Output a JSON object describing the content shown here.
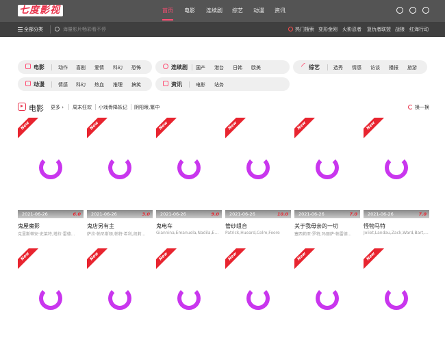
{
  "site": {
    "logo_text": "七度影视"
  },
  "nav": {
    "items": [
      "首页",
      "电影",
      "连续剧",
      "综艺",
      "动漫",
      "资讯"
    ],
    "active_index": 0
  },
  "subbar": {
    "all_categories": "全部分类",
    "search_placeholder": "海量影片畅彩看不停",
    "hot_label": "热门搜索",
    "hot_items": [
      "变形金刚",
      "火影忍者",
      "复仇者联盟",
      "战狼",
      "红海行动"
    ]
  },
  "categories": [
    {
      "title": "电影",
      "items": [
        "动作",
        "喜剧",
        "爱情",
        "科幻",
        "恐怖"
      ]
    },
    {
      "title": "连续剧",
      "items": [
        "国产",
        "港台",
        "日韩",
        "欧美"
      ]
    },
    {
      "title": "综艺",
      "items": [
        "选秀",
        "情感",
        "访谈",
        "播报",
        "旅游"
      ]
    },
    {
      "title": "动漫",
      "items": [
        "情感",
        "科幻",
        "热血",
        "推理",
        "搞笑"
      ]
    },
    {
      "title": "资讯",
      "items": [
        "电影",
        "站务"
      ]
    }
  ],
  "section": {
    "title": "电影",
    "more": "更多",
    "links": [
      "周末狂欢",
      "小戏骨降妖记",
      "阴阳眼,繁中"
    ],
    "refresh": "换一换"
  },
  "badge": "New",
  "movies": [
    {
      "date": "2021-06-26",
      "score": "6.0",
      "title": "鬼屋魔影",
      "cast": "克里斯蒂安·史莱特,塔拉·雷德..."
    },
    {
      "date": "2021-06-26",
      "score": "3.0",
      "title": "鬼店另有主",
      "cast": "萨拉·帕尼斯顿,帕特·希利,凯莉..."
    },
    {
      "date": "2021-06-26",
      "score": "9.0",
      "title": "鬼电车",
      "cast": "Giannina,Emanuela,Nadila,Em..."
    },
    {
      "date": "2021-06-26",
      "score": "10.0",
      "title": "管纱组合",
      "cast": "Patrick,Hueard,Colm,Feore"
    },
    {
      "date": "2021-06-26",
      "score": "7.0",
      "title": "关于我母亲的一切",
      "cast": "塞西莉亚·罗特,玛丽萨·帕雷德..."
    },
    {
      "date": "2021-06-26",
      "score": "7.0",
      "title": "怪物马特",
      "cast": "Joliet,Landau,Zack,Ward,Bart,..."
    },
    {
      "date": "",
      "score": "",
      "title": "",
      "cast": ""
    },
    {
      "date": "",
      "score": "",
      "title": "",
      "cast": ""
    },
    {
      "date": "",
      "score": "",
      "title": "",
      "cast": ""
    },
    {
      "date": "",
      "score": "",
      "title": "",
      "cast": ""
    },
    {
      "date": "",
      "score": "",
      "title": "",
      "cast": ""
    },
    {
      "date": "",
      "score": "",
      "title": "",
      "cast": ""
    }
  ]
}
